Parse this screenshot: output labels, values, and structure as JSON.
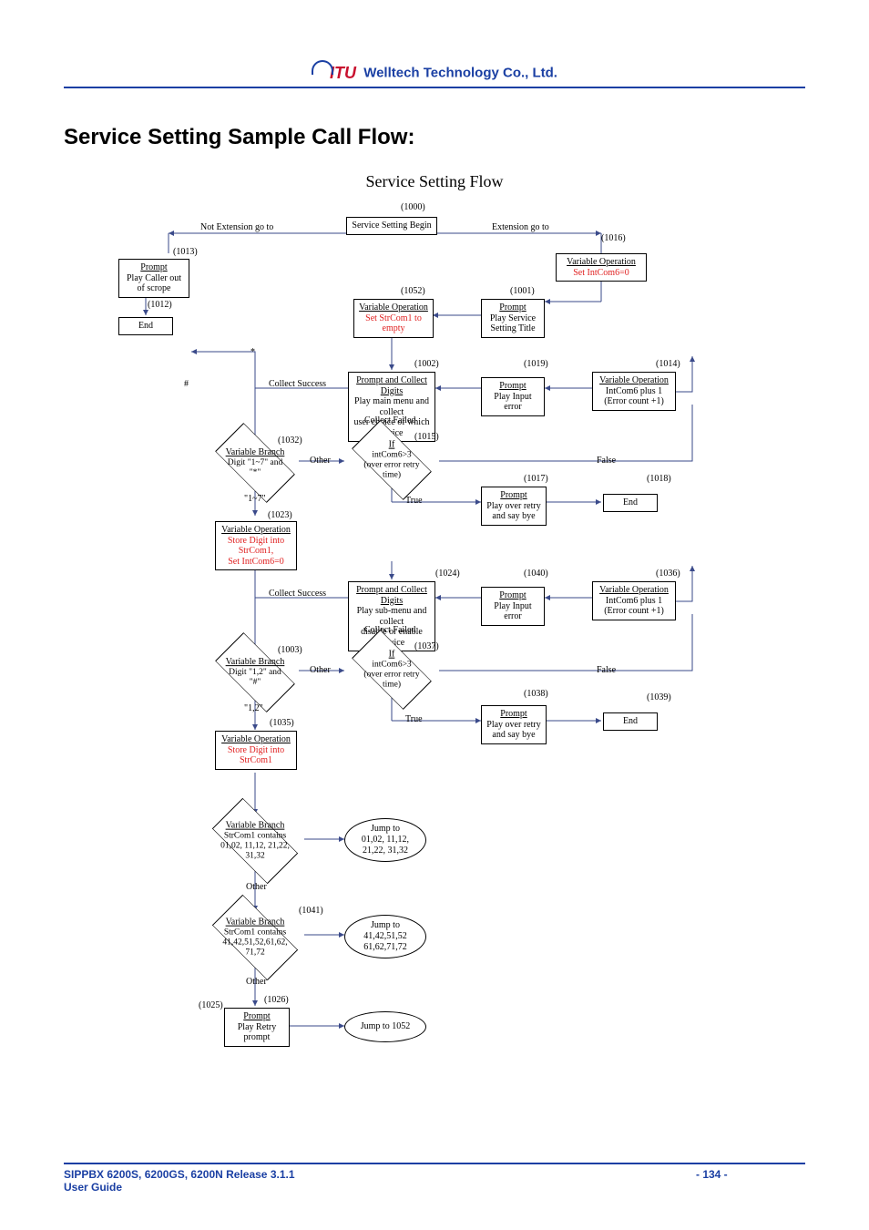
{
  "header": {
    "company": "Welltech Technology Co., Ltd."
  },
  "title": "Service Setting Sample Call Flow:",
  "flow_title": "Service Setting Flow",
  "footer": {
    "product": "SIPPBX 6200S, 6200GS, 6200N Release 3.1.1",
    "doc": "User Guide",
    "page": "- 134 -"
  },
  "nodes": {
    "n1000": {
      "id": "(1000)",
      "text": "Service Setting Begin"
    },
    "n1013": {
      "id": "(1013)",
      "title": "Prompt",
      "l1": "Play Caller out",
      "l2": "of scrope"
    },
    "n1012": {
      "id": "(1012)",
      "text": "End"
    },
    "n1016": {
      "id": "(1016)",
      "title": "Variable Operation",
      "l1": "Set IntCom6=0"
    },
    "n1052": {
      "id": "(1052)",
      "title": "Variable Operation",
      "l1": "Set StrCom1 to",
      "l2": "empty"
    },
    "n1001": {
      "id": "(1001)",
      "title": "Prompt",
      "l1": "Play Service",
      "l2": "Setting Title"
    },
    "n1002": {
      "id": "(1002)",
      "title": "Prompt and Collect Digits",
      "l1": "Play main menu and collect",
      "l2": "user choice of which sevice"
    },
    "n1019": {
      "id": "(1019)",
      "title": "Prompt",
      "l1": "Play Input error"
    },
    "n1014": {
      "id": "(1014)",
      "title": "Variable Operation",
      "l1": "IntCom6 plus 1",
      "l2": "(Error count +1)"
    },
    "n1032": {
      "id": "(1032)",
      "title": "Variable Branch",
      "l1": "Digit \"1~7\" and",
      "l2": "\"*\""
    },
    "n1015": {
      "id": "(1015)",
      "title": "If",
      "l1": "intCom6>3",
      "l2": "(over error retry",
      "l3": "time)"
    },
    "n1017": {
      "id": "(1017)",
      "title": "Prompt",
      "l1": "Play over retry",
      "l2": "and say bye"
    },
    "n1018": {
      "id": "(1018)",
      "text": "End"
    },
    "n1023": {
      "id": "(1023)",
      "title": "Variable Operation",
      "l1": "Store Digit into",
      "l2": "StrCom1,",
      "l3": "Set IntCom6=0"
    },
    "n1024": {
      "id": "(1024)",
      "title": "Prompt and Collect Digits",
      "l1": "Play sub-menu and collect",
      "l2": "disable or enable service"
    },
    "n1040": {
      "id": "(1040)",
      "title": "Prompt",
      "l1": "Play Input error"
    },
    "n1036": {
      "id": "(1036)",
      "title": "Variable Operation",
      "l1": "IntCom6 plus 1",
      "l2": "(Error count +1)"
    },
    "n1003": {
      "id": "(1003)",
      "title": "Variable Branch",
      "l1": "Digit \"1,2\" and",
      "l2": "\"#\""
    },
    "n1037": {
      "id": "(1037)",
      "title": "If",
      "l1": "intCom6>3",
      "l2": "(over error retry",
      "l3": "time)"
    },
    "n1038": {
      "id": "(1038)",
      "title": "Prompt",
      "l1": "Play over retry",
      "l2": "and say bye"
    },
    "n1039": {
      "id": "(1039)",
      "text": "End"
    },
    "n1035": {
      "id": "(1035)",
      "title": "Variable Operation",
      "l1": "Store Digit into",
      "l2": "StrCom1"
    },
    "nVB1": {
      "title": "Variable Branch",
      "l1": "StrCom1 contains",
      "l2": "01,02, 11,12, 21,22,",
      "l3": "31,32"
    },
    "n1041": {
      "id": "(1041)",
      "title": "Variable Branch",
      "l1": "StrCom1 contains",
      "l2": "41,42,51,52,61,62,",
      "l3": "71,72"
    },
    "n1025": {
      "id": "(1025)"
    },
    "n1026": {
      "id": "(1026)",
      "title": "Prompt",
      "l1": "Play Retry",
      "l2": "prompt"
    },
    "jump1": {
      "l1": "Jump to",
      "l2": "01,02, 11,12,",
      "l3": "21,22, 31,32"
    },
    "jump2": {
      "l1": "Jump to",
      "l2": "41,42,51,52",
      "l3": "61,62,71,72"
    },
    "jump3": {
      "text": "Jump to 1052"
    }
  },
  "labels": {
    "not_ext": "Not Extension go to",
    "ext": "Extension go to",
    "collect_success": "Collect Success",
    "collect_failed": "Collect Failed",
    "other": "Other",
    "true": "True",
    "false": "False",
    "star": "*",
    "hash": "#",
    "one_seven": "\"1~7\"",
    "one_two": "\"1,2\""
  }
}
